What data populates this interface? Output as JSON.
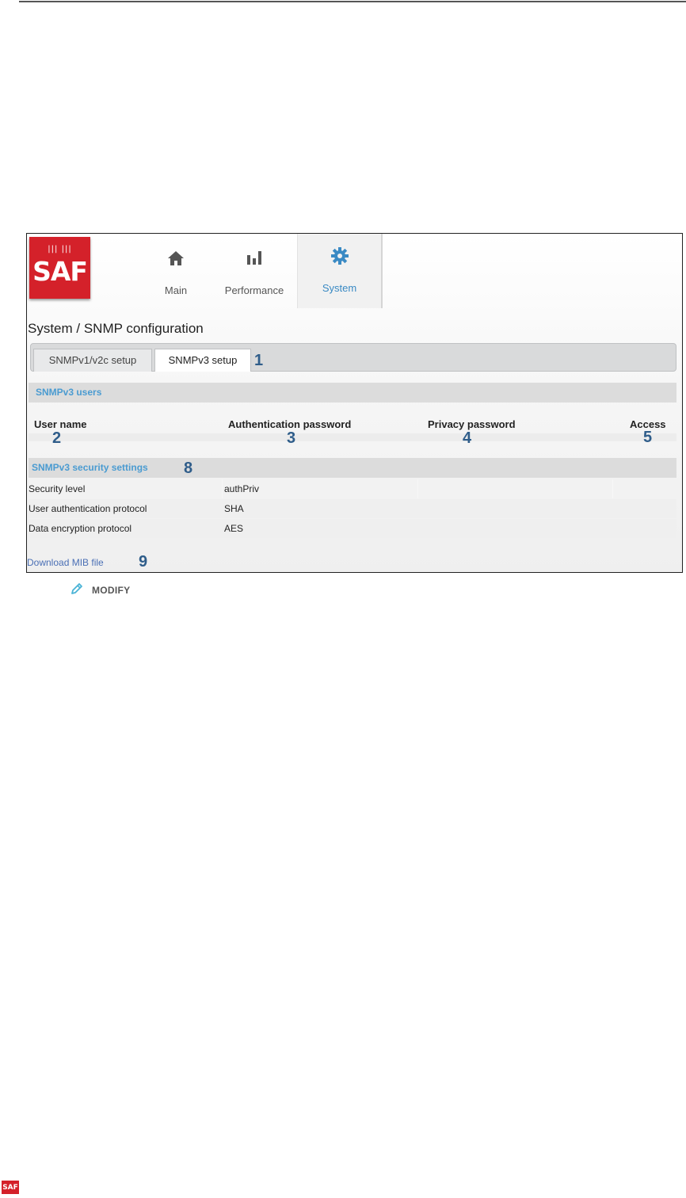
{
  "logo": {
    "text": "SAF",
    "bars": "||| |||"
  },
  "nav": [
    {
      "label": "Main",
      "icon": "home-icon"
    },
    {
      "label": "Performance",
      "icon": "bar-chart-icon"
    },
    {
      "label": "System",
      "icon": "gear-icon",
      "active": true
    }
  ],
  "page_title": "System / SNMP configuration",
  "tabs": [
    {
      "label": "SNMPv1/v2c setup",
      "active": false
    },
    {
      "label": "SNMPv3 setup",
      "active": true
    }
  ],
  "users_section": {
    "title": "SNMPv3 users",
    "columns": [
      "User name",
      "Authentication password",
      "Privacy password",
      "Access"
    ]
  },
  "security_section": {
    "title": "SNMPv3 security settings",
    "rows": [
      {
        "label": "Security level",
        "value": "authPriv"
      },
      {
        "label": "User authentication protocol",
        "value": "SHA"
      },
      {
        "label": "Data encryption protocol",
        "value": "AES"
      }
    ]
  },
  "download_link": "Download MIB file",
  "markers": [
    "1",
    "2",
    "3",
    "4",
    "5",
    "8",
    "9"
  ],
  "modify_label": "MODIFY",
  "footer_logo": "SAF",
  "colors": {
    "brand_red": "#d4212a",
    "accent_blue": "#3a8ac4",
    "marker_blue": "#2f5d8a"
  }
}
